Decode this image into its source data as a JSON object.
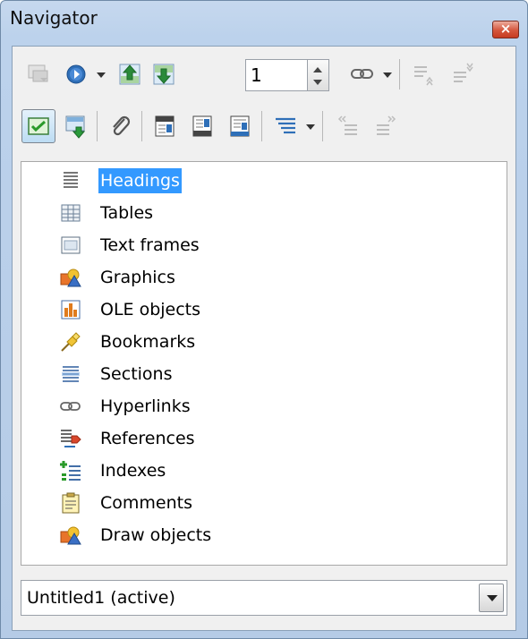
{
  "window": {
    "title": "Navigator",
    "close_glyph": "×"
  },
  "toolbar": {
    "row1": [
      {
        "icon": "content-view-icon",
        "enabled": false
      },
      {
        "icon": "navigation-icon",
        "enabled": true
      },
      {
        "icon": "previous-object-icon",
        "enabled": true
      },
      {
        "icon": "next-object-icon",
        "enabled": true
      },
      {
        "icon": "hyperlink-drag-mode-icon",
        "enabled": true
      },
      {
        "icon": "promote-level-icon",
        "enabled": false
      },
      {
        "icon": "demote-level-icon",
        "enabled": false
      }
    ],
    "page_number": "1",
    "row2": [
      {
        "icon": "toggle-icon",
        "enabled": true,
        "active": true
      },
      {
        "icon": "set-reminder-icon",
        "enabled": true
      },
      {
        "icon": "attachment-icon",
        "enabled": true
      },
      {
        "icon": "header-icon",
        "enabled": true
      },
      {
        "icon": "footer-icon",
        "enabled": true
      },
      {
        "icon": "anchor-text-icon",
        "enabled": true
      },
      {
        "icon": "heading-levels-icon",
        "enabled": true
      },
      {
        "icon": "promote-chapter-icon",
        "enabled": false
      },
      {
        "icon": "demote-chapter-icon",
        "enabled": false
      }
    ]
  },
  "tree": {
    "items": [
      {
        "label": "Headings",
        "icon": "headings-icon",
        "selected": true
      },
      {
        "label": "Tables",
        "icon": "tables-icon"
      },
      {
        "label": "Text frames",
        "icon": "text-frames-icon"
      },
      {
        "label": "Graphics",
        "icon": "graphics-icon"
      },
      {
        "label": "OLE objects",
        "icon": "ole-objects-icon"
      },
      {
        "label": "Bookmarks",
        "icon": "bookmarks-icon"
      },
      {
        "label": "Sections",
        "icon": "sections-icon"
      },
      {
        "label": "Hyperlinks",
        "icon": "hyperlinks-icon"
      },
      {
        "label": "References",
        "icon": "references-icon"
      },
      {
        "label": "Indexes",
        "icon": "indexes-icon"
      },
      {
        "label": "Comments",
        "icon": "comments-icon"
      },
      {
        "label": "Draw objects",
        "icon": "draw-objects-icon"
      }
    ]
  },
  "document_selector": {
    "value": "Untitled1 (active)"
  },
  "colors": {
    "selection": "#3399ff",
    "title_bar": "#c6d8ee",
    "close_button": "#d4563d"
  }
}
